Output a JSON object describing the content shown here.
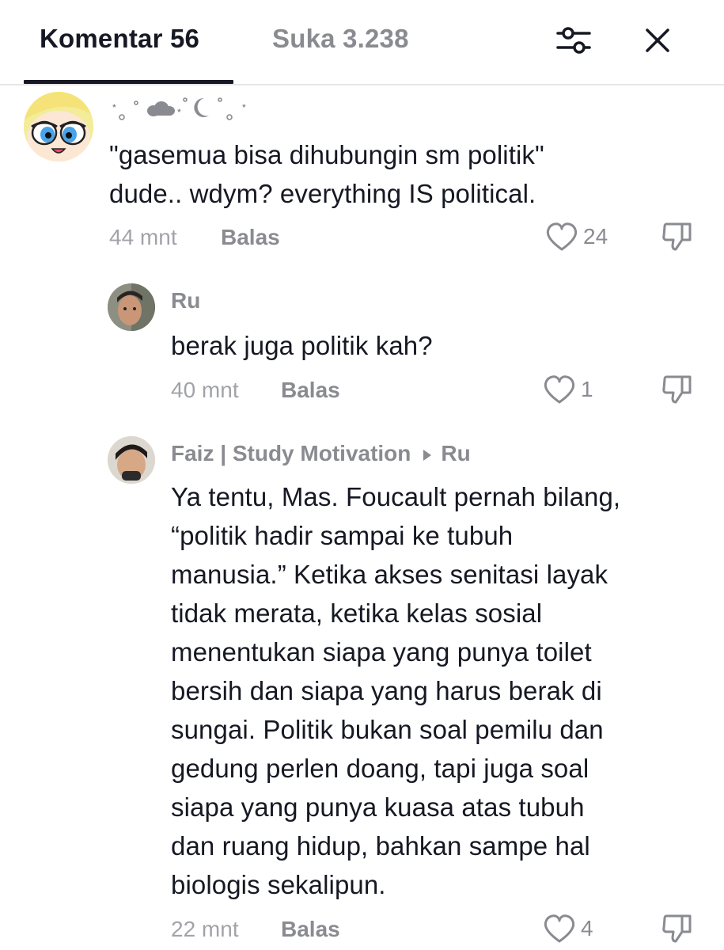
{
  "header": {
    "tab_comments": "Komentar 56",
    "tab_likes": "Suka 3.238",
    "filter_icon": "sliders-icon",
    "close_icon": "close-icon"
  },
  "comments": [
    {
      "username_deco": "⋆˚｡☁︎⋆☾˚｡⋆",
      "lines": [
        "\"gasemua bisa dihubungin sm politik\"",
        "dude.. wdym? everything IS political."
      ],
      "time": "44 mnt",
      "reply_label": "Balas",
      "likes": "24"
    },
    {
      "username": "Ru",
      "lines": [
        "berak juga politik kah?"
      ],
      "time": "40 mnt",
      "reply_label": "Balas",
      "likes": "1"
    },
    {
      "username": "Faiz | Study Motivation",
      "reply_to": "Ru",
      "lines": [
        "Ya tentu, Mas. Foucault pernah bilang,",
        "“politik hadir sampai ke tubuh",
        "manusia.” Ketika akses senitasi layak",
        "tidak merata, ketika kelas sosial",
        "menentukan siapa yang punya toilet",
        "bersih dan siapa yang harus berak di",
        "sungai. Politik bukan soal pemilu dan",
        "gedung perlen doang, tapi juga soal",
        "siapa yang punya kuasa atas tubuh",
        "dan ruang hidup, bahkan sampe hal",
        "biologis sekalipun."
      ],
      "time": "22 mnt",
      "reply_label": "Balas",
      "likes": "4"
    }
  ],
  "colors": {
    "primary_text": "#161823",
    "secondary_text": "#8a8b91",
    "divider": "#e6e6e8"
  }
}
